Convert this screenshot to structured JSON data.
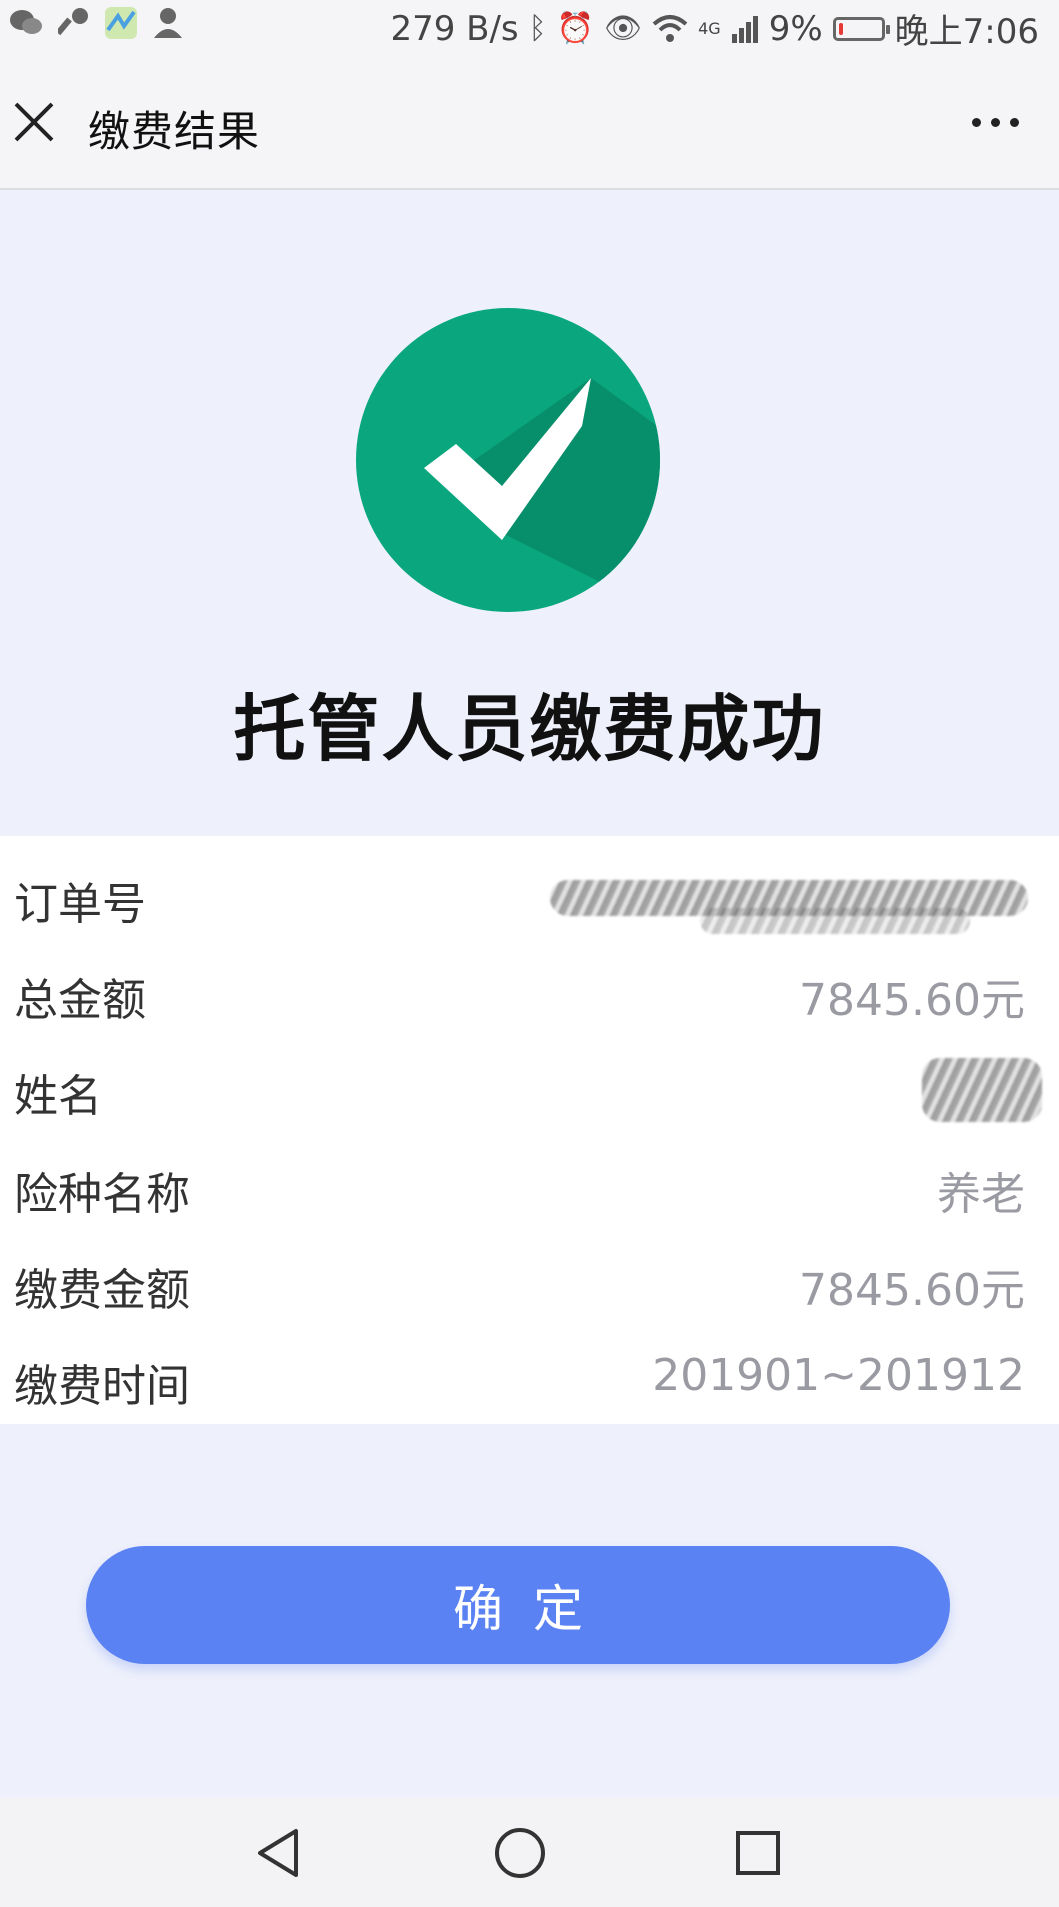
{
  "status_bar": {
    "speed": "279 B/s",
    "network": "4G",
    "battery_percent": "9%",
    "battery_level": 0.09,
    "time": "晚上7:06"
  },
  "nav": {
    "title": "缴费结果"
  },
  "result": {
    "title": "托管人员缴费成功",
    "icon": "check-circle-icon",
    "accent_color": "#0aa77e"
  },
  "details": [
    {
      "label": "订单号",
      "value": ""
    },
    {
      "label": "总金额",
      "value": "7845.60元"
    },
    {
      "label": "姓名",
      "value": ""
    },
    {
      "label": "险种名称",
      "value": "养老"
    },
    {
      "label": "缴费金额",
      "value": "7845.60元"
    },
    {
      "label": "缴费时间",
      "value": "201901~201912"
    }
  ],
  "confirm_button": {
    "label": "确定",
    "color": "#5b82f3"
  }
}
